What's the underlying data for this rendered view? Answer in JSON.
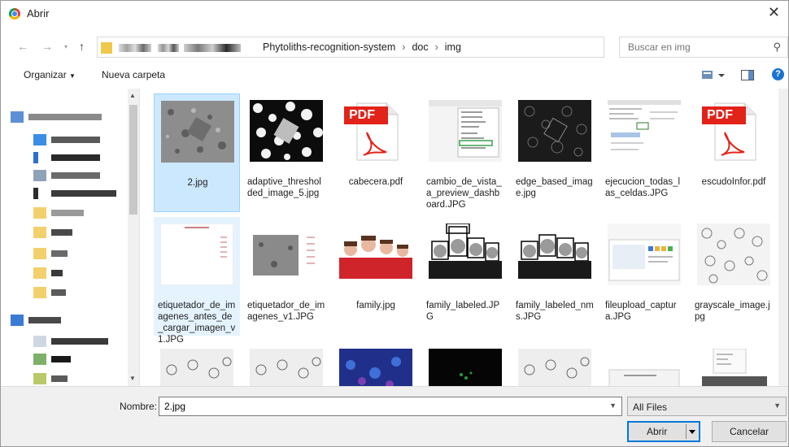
{
  "window": {
    "title": "Abrir"
  },
  "address": {
    "crumbs": [
      "Phytoliths-recognition-system",
      "doc",
      "img"
    ],
    "search_placeholder": "Buscar en img"
  },
  "toolbar": {
    "organize_label": "Organizar",
    "new_folder_label": "Nueva carpeta"
  },
  "files": [
    {
      "name": "2.jpg",
      "selected": true
    },
    {
      "name": "adaptive_thresholded_image_5.jpg"
    },
    {
      "name": "cabecera.pdf"
    },
    {
      "name": "cambio_de_vista_a_preview_dashboard.JPG"
    },
    {
      "name": "edge_based_image.jpg"
    },
    {
      "name": "ejecucion_todas_las_celdas.JPG"
    },
    {
      "name": "escudoInfor.pdf"
    },
    {
      "name": "etiquetador_de_imagenes_antes_de_cargar_imagen_v1.JPG"
    },
    {
      "name": "etiquetador_de_imagenes_v1.JPG"
    },
    {
      "name": "family.jpg"
    },
    {
      "name": "family_labeled.JPG"
    },
    {
      "name": "family_labeled_nms.JPG"
    },
    {
      "name": "fileupload_captura.JPG"
    },
    {
      "name": "grayscale_image.jpg"
    }
  ],
  "pdf_icon_text": "PDF",
  "bottom": {
    "name_label": "Nombre:",
    "name_value": "2.jpg",
    "filter_value": "All Files",
    "open_label": "Abrir",
    "cancel_label": "Cancelar"
  },
  "colors": {
    "accent": "#0078d7",
    "selection": "#cce8ff",
    "pdf_red": "#e2231a"
  }
}
